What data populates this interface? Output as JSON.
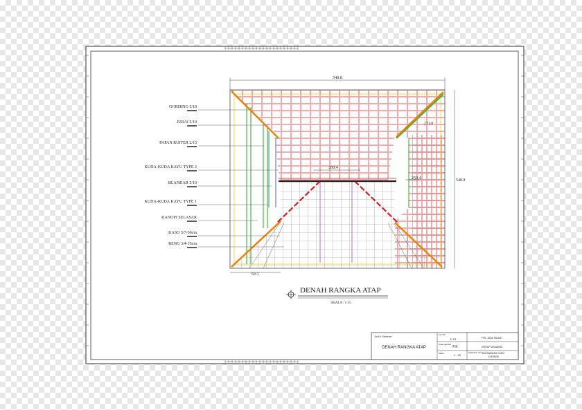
{
  "drawing": {
    "title": "DENAH RANGKA ATAP",
    "scale": "SKALA : 1:35"
  },
  "labels": [
    "GORDING 5/10",
    "JURAI 5/10",
    "PAPAN RUITER 2/15",
    "KUDA-KUDA KAYU TYPE 2",
    "BLANDAR 5/10",
    "KUDA-KUDA KAYU TYPE 1",
    "KANOPI SELASAR",
    "KASO 5/7-50cm",
    "RENG 3/4-35cm"
  ],
  "dimensions": {
    "top": "540.8",
    "right": "540.8",
    "upper_right": "211.0",
    "inner_width": "350.4",
    "inner_right": "250.4",
    "bottom_left": "50.3"
  },
  "title_block": {
    "judul_label": "Judul Gambar",
    "judul_value": "DENAH RANGKA ATAP",
    "lembar_label": "Lembar",
    "lembar_value": "F-15",
    "kode_label": "Kode gambar",
    "kode_value": "P.K",
    "skala_label": "Skala",
    "skala_value": "1 : 35",
    "org_1": "POL JADA PALMO",
    "org_2": "GROUP DRAWING",
    "person_label": "Digambar oleh",
    "person_name": "MOHAMMAD YUDO",
    "person_id": "12345635"
  },
  "colors": {
    "tile_red": "#e8898a",
    "jurai_orange": "#e8800a",
    "green": "#44b344",
    "diag_red": "#cc1f1f",
    "frame": "#333333"
  }
}
